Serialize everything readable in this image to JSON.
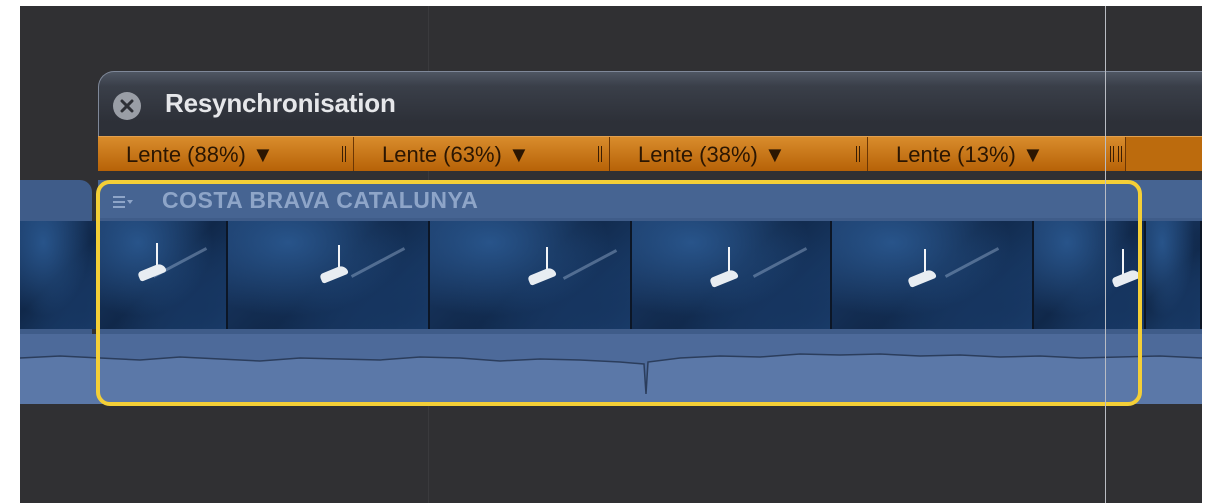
{
  "retime_editor": {
    "title": "Resynchronisation",
    "segments": [
      {
        "label": "Lente (88%) ▼",
        "speed_percent": 88
      },
      {
        "label": "Lente (63%) ▼",
        "speed_percent": 63
      },
      {
        "label": "Lente (38%) ▼",
        "speed_percent": 38
      },
      {
        "label": "Lente (13%) ▼",
        "speed_percent": 13
      }
    ]
  },
  "clip": {
    "name": "COSTA BRAVA CATALUNYA",
    "menu_icon": "clip-menu-icon"
  },
  "colors": {
    "timeline_bg": "#303033",
    "retime_orange": "#bc6b0d",
    "clip_blue": "#3f5c89",
    "selection_yellow": "#f4cf37"
  }
}
